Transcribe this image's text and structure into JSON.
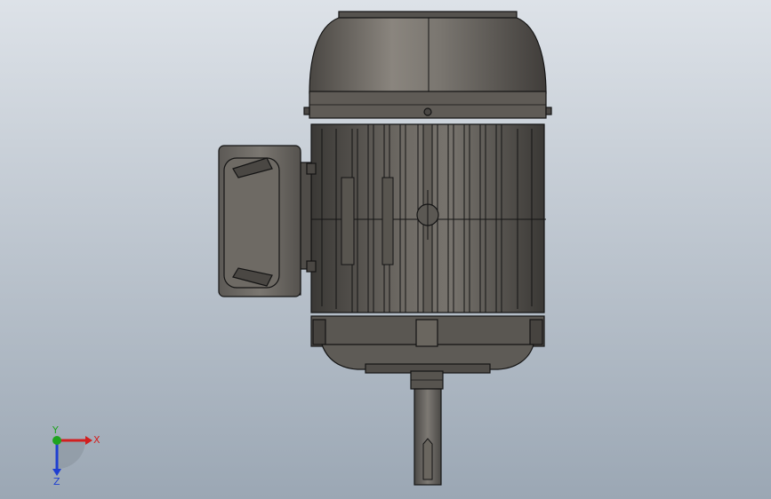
{
  "viewport": {
    "background_top": "#d9dfe6",
    "background_bottom": "#9aa6b3",
    "model_colors": {
      "body_dark": "#3f3d3a",
      "body_mid": "#6b6761",
      "body_light": "#8e8a83",
      "edge": "#141414"
    }
  },
  "triad": {
    "x_label": "X",
    "y_label": "Y",
    "z_label": "Z",
    "x_color": "#d21f1f",
    "y_color": "#1fa31f",
    "z_color": "#1f3fd2"
  }
}
